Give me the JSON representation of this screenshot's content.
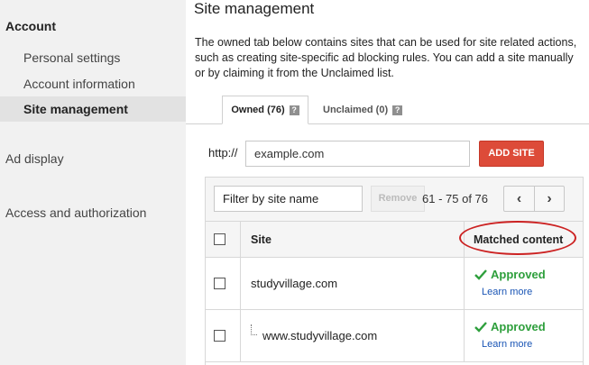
{
  "sidebar": {
    "account_heading": "Account",
    "items": [
      {
        "label": "Personal settings"
      },
      {
        "label": "Account information"
      },
      {
        "label": "Site management"
      },
      {
        "label": "Ad display"
      },
      {
        "label": "Access and authorization"
      }
    ]
  },
  "main": {
    "title": "Site management",
    "description": "The owned tab below contains sites that can be used for site related actions, such as creating site-specific ad blocking rules. You can add a site manually or by claiming it from the Unclaimed list.",
    "tabs": [
      {
        "label": "Owned (76)",
        "help": "?"
      },
      {
        "label": "Unclaimed (0)",
        "help": "?"
      }
    ],
    "add_site": {
      "prefix": "http://",
      "input_value": "example.com",
      "button_label": "ADD SITE"
    },
    "table": {
      "filter_placeholder": "Filter by site name",
      "remove_label": "Remove",
      "pagination": "61 - 75 of 76",
      "prev": "‹",
      "next": "›",
      "columns": [
        "Site",
        "Matched content"
      ],
      "rows": [
        {
          "site": "studyvillage.com",
          "status": "Approved",
          "link": "Learn more"
        },
        {
          "site": "www.studyvillage.com",
          "status": "Approved",
          "link": "Learn more"
        }
      ]
    }
  },
  "colors": {
    "accent_red": "#dd4b39",
    "approved_green": "#2e9f3c",
    "link_blue": "#1a55b5",
    "annotation_red": "#cc2222"
  }
}
